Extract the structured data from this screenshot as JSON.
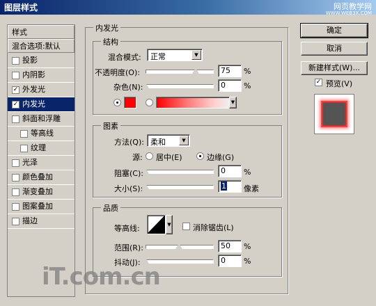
{
  "window": {
    "title": "图层样式",
    "watermark_line1": "网页教学网",
    "watermark_line2": "WWW.WEB3X.COM"
  },
  "stylelist": {
    "header": "样式",
    "blend_default": "混合选项:默认",
    "items": [
      {
        "label": "投影",
        "checked": false,
        "selected": false,
        "indent": false
      },
      {
        "label": "内阴影",
        "checked": false,
        "selected": false,
        "indent": false
      },
      {
        "label": "外发光",
        "checked": true,
        "selected": false,
        "indent": false
      },
      {
        "label": "内发光",
        "checked": true,
        "selected": true,
        "indent": false
      },
      {
        "label": "斜面和浮雕",
        "checked": false,
        "selected": false,
        "indent": false
      },
      {
        "label": "等高线",
        "checked": false,
        "selected": false,
        "indent": true
      },
      {
        "label": "纹理",
        "checked": false,
        "selected": false,
        "indent": true
      },
      {
        "label": "光泽",
        "checked": false,
        "selected": false,
        "indent": false
      },
      {
        "label": "颜色叠加",
        "checked": false,
        "selected": false,
        "indent": false
      },
      {
        "label": "渐变叠加",
        "checked": false,
        "selected": false,
        "indent": false
      },
      {
        "label": "图案叠加",
        "checked": false,
        "selected": false,
        "indent": false
      },
      {
        "label": "描边",
        "checked": false,
        "selected": false,
        "indent": false
      }
    ]
  },
  "inner_glow": {
    "title": "内发光",
    "structure": {
      "title": "结构",
      "blend_mode_label": "混合模式:",
      "blend_mode_value": "正常",
      "opacity_label": "不透明度(O):",
      "opacity_value": "75",
      "opacity_unit": "%",
      "opacity_level": 0.75,
      "noise_label": "杂色(N):",
      "noise_value": "0",
      "noise_unit": "%",
      "noise_level": 0,
      "glow_color": "#ff0000"
    },
    "elements": {
      "title": "图素",
      "method_label": "方法(Q):",
      "method_value": "柔和",
      "source_label": "源:",
      "source_center": "居中(E)",
      "source_edge": "边缘(G)",
      "choke_label": "阻塞(C):",
      "choke_value": "0",
      "choke_unit": "%",
      "choke_level": 0,
      "size_label": "大小(S):",
      "size_value": "1",
      "size_unit": "像素",
      "size_level": 0.004
    },
    "quality": {
      "title": "品质",
      "contour_label": "等高线:",
      "antialias_label": "消除锯齿(L)",
      "range_label": "范围(R):",
      "range_value": "50",
      "range_unit": "%",
      "range_level": 0.5,
      "jitter_label": "抖动(J):",
      "jitter_value": "0",
      "jitter_unit": "%",
      "jitter_level": 0
    }
  },
  "buttons": {
    "ok": "确定",
    "cancel": "取消",
    "new_style": "新建样式(W)...",
    "preview": "预览(V)"
  },
  "footer_logo": "iT.com.cn"
}
